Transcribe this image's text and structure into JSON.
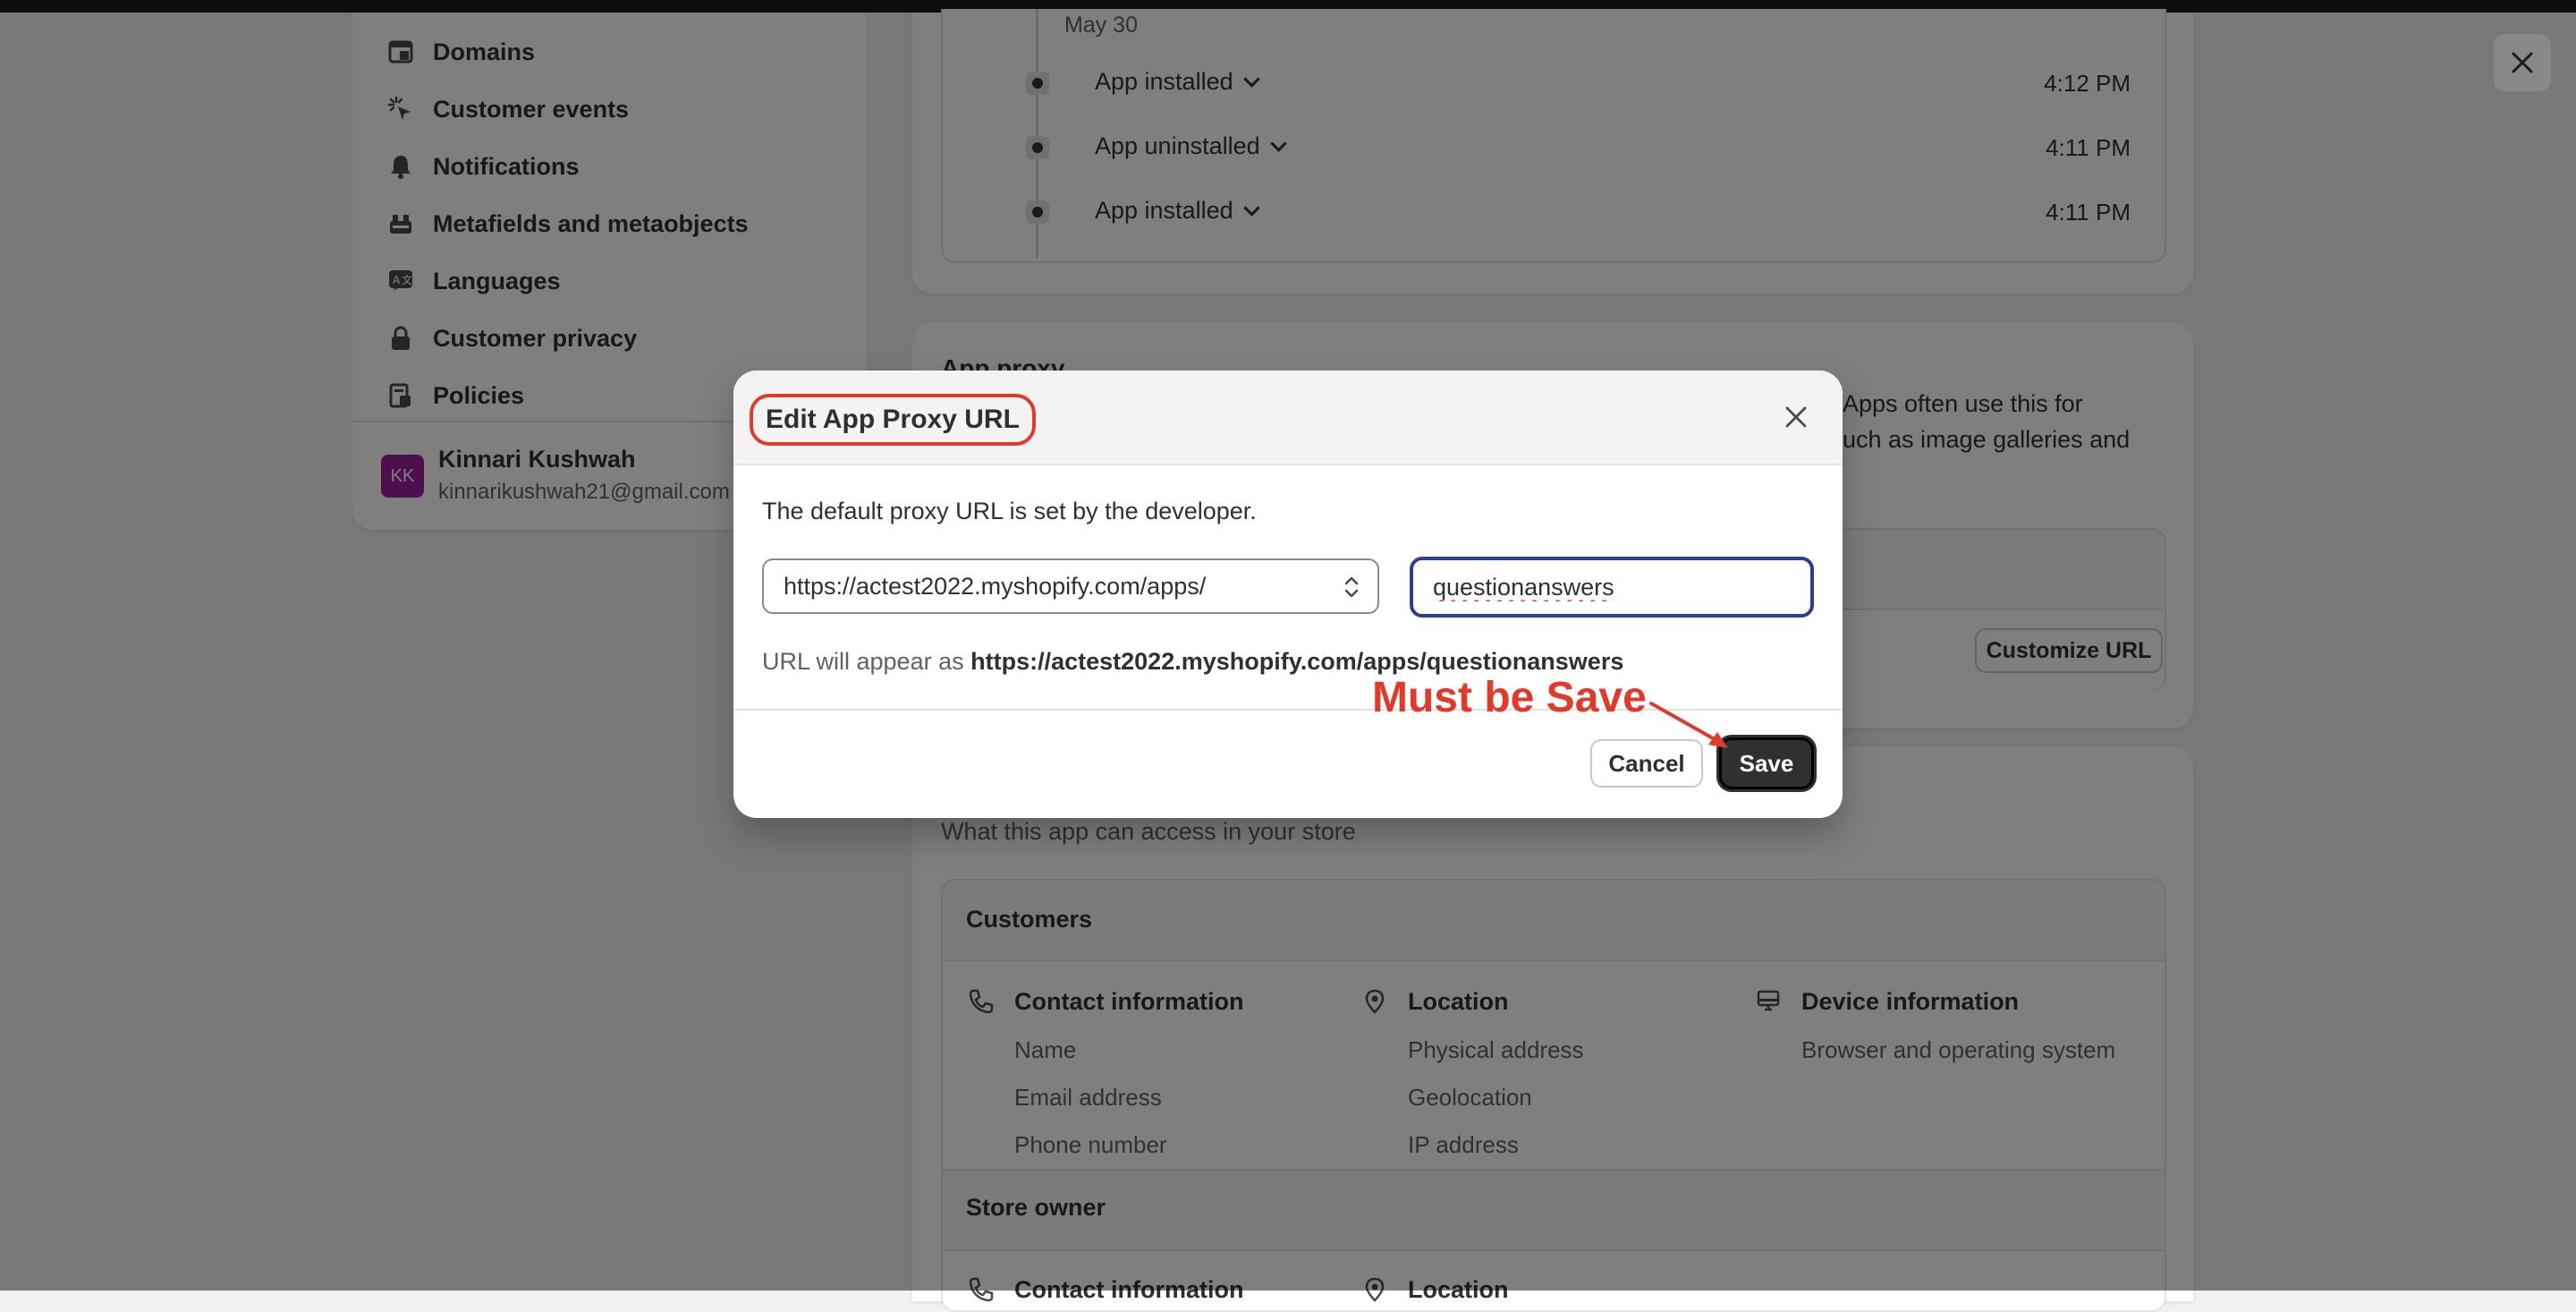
{
  "sidebar": {
    "items": [
      {
        "label": "Domains",
        "icon": "domains-icon"
      },
      {
        "label": "Customer events",
        "icon": "cursor-click-icon"
      },
      {
        "label": "Notifications",
        "icon": "bell-icon"
      },
      {
        "label": "Metafields and metaobjects",
        "icon": "metafields-icon"
      },
      {
        "label": "Languages",
        "icon": "language-icon"
      },
      {
        "label": "Customer privacy",
        "icon": "lock-icon"
      },
      {
        "label": "Policies",
        "icon": "policies-icon"
      }
    ],
    "user": {
      "initials": "KK",
      "name": "Kinnari Kushwah",
      "email": "kinnarikushwah21@gmail.com"
    }
  },
  "history": {
    "date": "May 30",
    "events": [
      {
        "label": "App installed",
        "time": "4:12 PM"
      },
      {
        "label": "App uninstalled",
        "time": "4:11 PM"
      },
      {
        "label": "App installed",
        "time": "4:11 PM"
      }
    ]
  },
  "app_proxy": {
    "title": "App proxy",
    "desc_line1": "Apps often use this for",
    "desc_line2": "uch as image galleries and",
    "customize_button": "Customize URL"
  },
  "permissions": {
    "subtitle": "What this app can access in your store",
    "customers_title": "Customers",
    "columns": [
      {
        "title": "Contact information",
        "icon": "phone-icon",
        "items": [
          "Name",
          "Email address",
          "Phone number"
        ]
      },
      {
        "title": "Location",
        "icon": "location-pin-icon",
        "items": [
          "Physical address",
          "Geolocation",
          "IP address"
        ]
      },
      {
        "title": "Device information",
        "icon": "monitor-icon",
        "items": [
          "Browser and operating system"
        ]
      }
    ],
    "store_owner_title": "Store owner",
    "store_owner_col1": "Contact information",
    "store_owner_col2": "Location"
  },
  "modal": {
    "title": "Edit App Proxy URL",
    "description": "The default proxy URL is set by the developer.",
    "select_value": "https://actest2022.myshopify.com/apps/",
    "input_value": "questionanswers",
    "preview_prefix": "URL will appear as",
    "preview_url": "https://actest2022.myshopify.com/apps/questionanswers",
    "cancel_label": "Cancel",
    "save_label": "Save"
  },
  "annotation": {
    "text": "Must be Save",
    "color": "#e03a2d"
  },
  "colors": {
    "primary_button": "#303030",
    "focus_ring": "#2c3e8c",
    "avatar": "#9c1f9c"
  }
}
